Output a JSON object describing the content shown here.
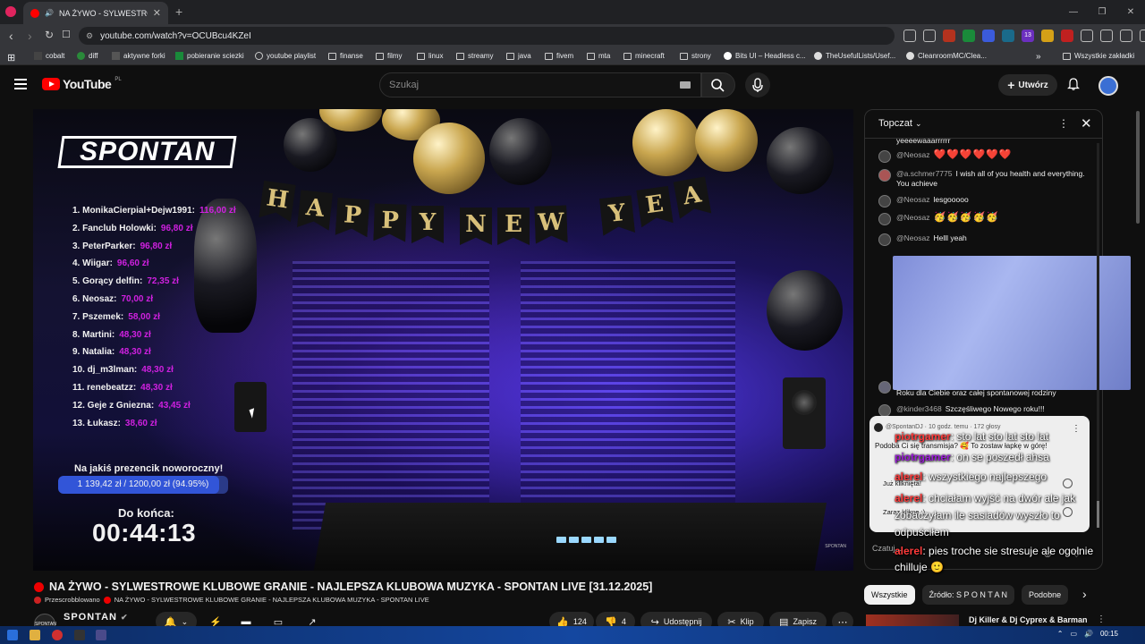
{
  "browser": {
    "tab_title": "NA ŻYWO - SYLWESTROW",
    "url": "youtube.com/watch?v=OCUBcu4KZeI",
    "bookmarks": [
      "cobalt",
      "diff",
      "aktywne forki",
      "pobieranie sciezki",
      "youtube playlist",
      "finanse",
      "filmy",
      "linux",
      "streamy",
      "java",
      "fivem",
      "mta",
      "minecraft",
      "strony",
      "Bits UI – Headless c...",
      "TheUsefulLists/Usef...",
      "CleanroomMC/Clea..."
    ],
    "all_bookmarks": "Wszystkie zakładki",
    "ext_badge": "13"
  },
  "youtube": {
    "logo": "YouTube",
    "region": "PL",
    "search_placeholder": "Szukaj",
    "create_label": "Utwórz"
  },
  "overlay": {
    "logo": "SPONTAN",
    "donors": [
      {
        "name": "1. MonikaCierpial+Dejw1991:",
        "amount": "116,00 zł"
      },
      {
        "name": "2. Fanclub Holowki:",
        "amount": "96,80 zł"
      },
      {
        "name": "3. PeterParker:",
        "amount": "96,80 zł"
      },
      {
        "name": "4. Wiigar:",
        "amount": "96,60 zł"
      },
      {
        "name": "5. Gorący delfin:",
        "amount": "72,35 zł"
      },
      {
        "name": "6. Neosaz:",
        "amount": "70,00 zł"
      },
      {
        "name": "7. Pszemek:",
        "amount": "58,00 zł"
      },
      {
        "name": "8. Martini:",
        "amount": "48,30 zł"
      },
      {
        "name": "9. Natalia:",
        "amount": "48,30 zł"
      },
      {
        "name": "10. dj_m3lman:",
        "amount": "48,30 zł"
      },
      {
        "name": "11. renebeatzz:",
        "amount": "48,30 zł"
      },
      {
        "name": "12. Geje z Gniezna:",
        "amount": "43,45 zł"
      },
      {
        "name": "13. Łukasz:",
        "amount": "38,60 zł"
      }
    ],
    "goal_title": "Na jakiś prezencik noworoczny!",
    "goal_text": "1 139,42 zł / 1200,00 zł (94.95%)",
    "goal_percent": 94.95,
    "countdown_label": "Do końca:",
    "countdown": "00:44:13",
    "banner_letters": [
      "H",
      "A",
      "P",
      "P",
      "Y",
      "N",
      "E",
      "W",
      "Y",
      "E",
      "A"
    ],
    "watermark": "SPONTAN"
  },
  "chat": {
    "title": "Topczat",
    "messages": [
      {
        "author": "",
        "text": "yeeeewaaarrrrrr"
      },
      {
        "author": "@Neosaz",
        "text": "❤️❤️❤️❤️❤️❤️"
      },
      {
        "author": "@a.schmer7775",
        "text": "I wish all of you health and everything. You achieve"
      },
      {
        "author": "@Neosaz",
        "text": "lesgooooo"
      },
      {
        "author": "@Neosaz",
        "text": "🥳🥳🥳🥳🥳"
      },
      {
        "author": "@Neosaz",
        "text": "Helll yeah"
      },
      {
        "author": "",
        "text": "Roku dla Ciebie oraz całej spontanowej rodziny"
      },
      {
        "author": "@kinder3468",
        "text": "Szczęśliwego Nowego roku!!!"
      }
    ],
    "poll": {
      "meta": "@SpontanDJ · 10 godz. temu · 172 głosy",
      "question": "Podoba Ci się transmisja? 🥰 To zostaw łapkę w górę!",
      "option1": "Już kliknięta!",
      "option2": "Zaraz kliknę :)"
    },
    "overlay_msgs": [
      {
        "name": "piotrgamer",
        "text": "sto lat sto lat sto lat"
      },
      {
        "name": "piotrgamer",
        "text": "on se poszedł ahsa"
      },
      {
        "name": "alerel",
        "text": "wszystkiego najlepszego"
      },
      {
        "name": "alerel",
        "text": "chciałam wyjść na dwór ale jak zobaczyłam ile sasiadów wyszło to odpuściłem"
      },
      {
        "name": "alerel",
        "text": "pies troche sie stresuje ale ogolnie chilluje 🙂"
      }
    ],
    "input_placeholder": "Czatuj..."
  },
  "video": {
    "title": "NA ŻYWO - SYLWESTROWE KLUBOWE GRANIE - NAJLEPSZA KLUBOWA MUZYKA - SPONTAN LIVE [31.12.2025]",
    "sub_label": "Przescrobblowano",
    "sub_title": "NA ŻYWO - SYLWESTROWE KLUBOWE GRANIE - NAJLEPSZA KLUBOWA MUZYKA - SPONTAN LIVE",
    "channel": "SPONTAN",
    "likes": "124",
    "dislikes": "4",
    "share": "Udostępnij",
    "clip": "Klip",
    "save": "Zapisz"
  },
  "sidebar": {
    "chips": [
      "Wszystkie",
      "Źródło: S P O N T A N",
      "Podobne"
    ],
    "related_title": "Dj Killer & Dj Cyprex & Barman"
  },
  "taskbar": {
    "time": "00:15"
  }
}
